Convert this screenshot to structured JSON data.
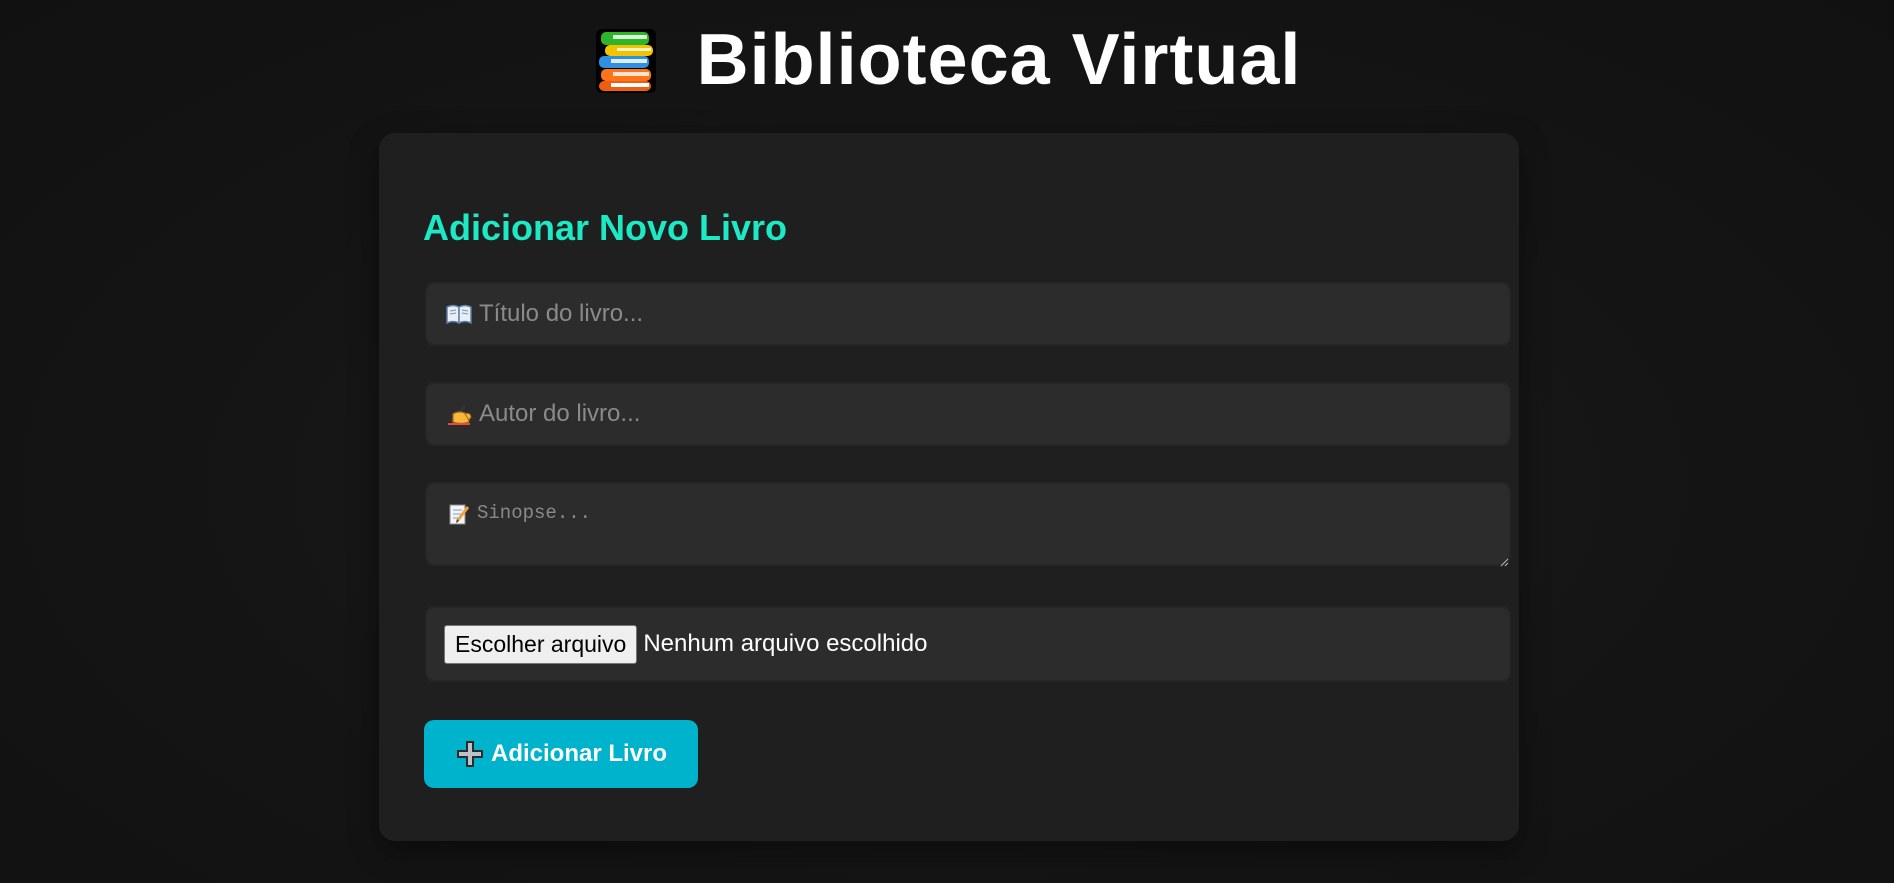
{
  "header": {
    "title": "Biblioteca Virtual",
    "icon": "books-stack-icon"
  },
  "form": {
    "heading": "Adicionar Novo Livro",
    "title_field": {
      "icon": "open-book-icon",
      "placeholder": "Título do livro...",
      "value": ""
    },
    "author_field": {
      "icon": "writing-hand-icon",
      "placeholder": "Autor do livro...",
      "value": ""
    },
    "synopsis_field": {
      "icon": "memo-icon",
      "placeholder": "Sinopse...",
      "value": ""
    },
    "file_field": {
      "button_label": "Escolher arquivo",
      "status": "Nenhum arquivo escolhido"
    },
    "submit": {
      "icon": "plus-icon",
      "label": "Adicionar Livro"
    }
  },
  "colors": {
    "background": "#131313",
    "card": "#1f1f1f",
    "field": "#2c2c2c",
    "accent_heading": "#1de9c5",
    "button": "#00b3cc",
    "placeholder": "#8a8a8a"
  }
}
